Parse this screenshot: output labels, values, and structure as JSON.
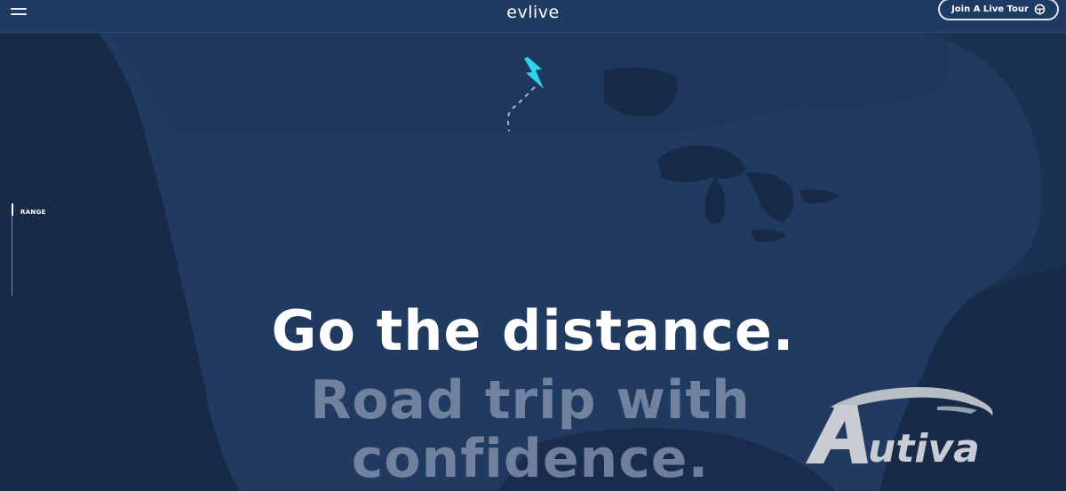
{
  "header": {
    "brand": "evlive",
    "tour_button_label": "Join A Live Tour"
  },
  "sidebar": {
    "range_label": "RANGE"
  },
  "hero": {
    "headline": "Go the distance.",
    "subline_1": "Road trip with",
    "subline_2": "confidence."
  },
  "watermark": {
    "text": "Autiva"
  },
  "colors": {
    "background": "#1b3152",
    "header": "#1f3a63",
    "accent_bolt": "#2fd4e8",
    "subline": "#8c9bb3"
  },
  "icons": [
    "menu-icon",
    "steering-wheel-icon",
    "lightning-bolt-icon"
  ]
}
